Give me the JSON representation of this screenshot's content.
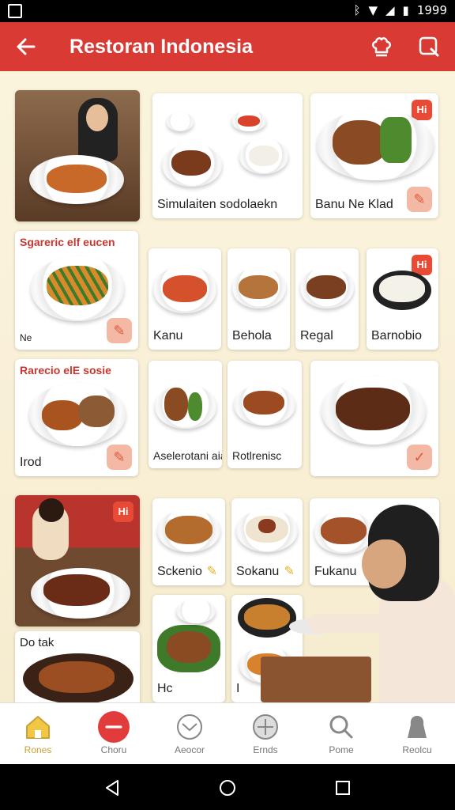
{
  "status_bar": {
    "time": "1999"
  },
  "app_bar": {
    "title": "Restoran Indonesia"
  },
  "cards": {
    "c1_label": "Simulaiten sodolaekn",
    "c2_label": "Banu Ne Klad",
    "c2_badge": "Hi",
    "c3_head": "Sgareric elf eucen",
    "c3_small": "Ne",
    "c4_label": "Kanu",
    "c5_label": "Behola",
    "c6_label": "Regal",
    "c7_label": "Barnobio",
    "c7_badge": "Hi",
    "c8_head": "Rarecio elE sosie",
    "c8_label": "Irod",
    "c9_label": "Aselerotani aia",
    "c10_label": "Rotlrenisc",
    "c11_badge": "Hi",
    "c12_label": "Sckenio",
    "c13_label": "Sokanu",
    "c14_label": "Fukanu",
    "c15_head": "Do tak",
    "c16_label": "Hc",
    "c17_label": "I"
  },
  "bottom_nav": [
    {
      "label": "Rones",
      "icon": "home-icon",
      "active": true
    },
    {
      "label": "Choru",
      "icon": "menu-icon",
      "active": false
    },
    {
      "label": "Aeocor",
      "icon": "offers-icon",
      "active": false
    },
    {
      "label": "Ernds",
      "icon": "settings-icon",
      "active": false
    },
    {
      "label": "Pome",
      "icon": "search-icon",
      "active": false
    },
    {
      "label": "Reolcu",
      "icon": "profile-icon",
      "active": false
    }
  ],
  "colors": {
    "primary": "#d93a33",
    "background": "#f7efd8",
    "active_nav": "#c9a13a"
  }
}
